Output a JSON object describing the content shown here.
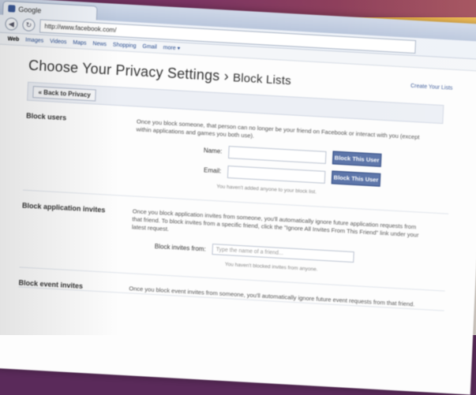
{
  "browser": {
    "tab_title": "Google",
    "url": "http://www.facebook.com/",
    "bookmarks": [
      "Web",
      "Images",
      "Videos",
      "Maps",
      "News",
      "Shopping",
      "Gmail",
      "more ▾"
    ]
  },
  "header": {
    "title": "Choose Your Privacy Settings",
    "separator": "›",
    "subtitle": "Block Lists",
    "top_link": "Create Your Lists"
  },
  "back_button_label": "« Back to Privacy",
  "block_users": {
    "label": "Block users",
    "description": "Once you block someone, that person can no longer be your friend on Facebook or interact with you (except within applications and games you both use).",
    "name_label": "Name:",
    "email_label": "Email:",
    "block_name_btn": "Block This User",
    "block_email_btn": "Block This User",
    "note": "You haven't added anyone to your block list."
  },
  "block_app_invites": {
    "label": "Block application invites",
    "description": "Once you block application invites from someone, you'll automatically ignore future application requests from that friend. To block invites from a specific friend, click the \"Ignore All Invites From This Friend\" link under your latest request.",
    "invite_label": "Block invites from:",
    "invite_placeholder": "Type the name of a friend...",
    "note": "You haven't blocked invites from anyone."
  },
  "block_event_invites": {
    "label": "Block event invites",
    "description": "Once you block event invites from someone, you'll automatically ignore future event requests from that friend."
  }
}
